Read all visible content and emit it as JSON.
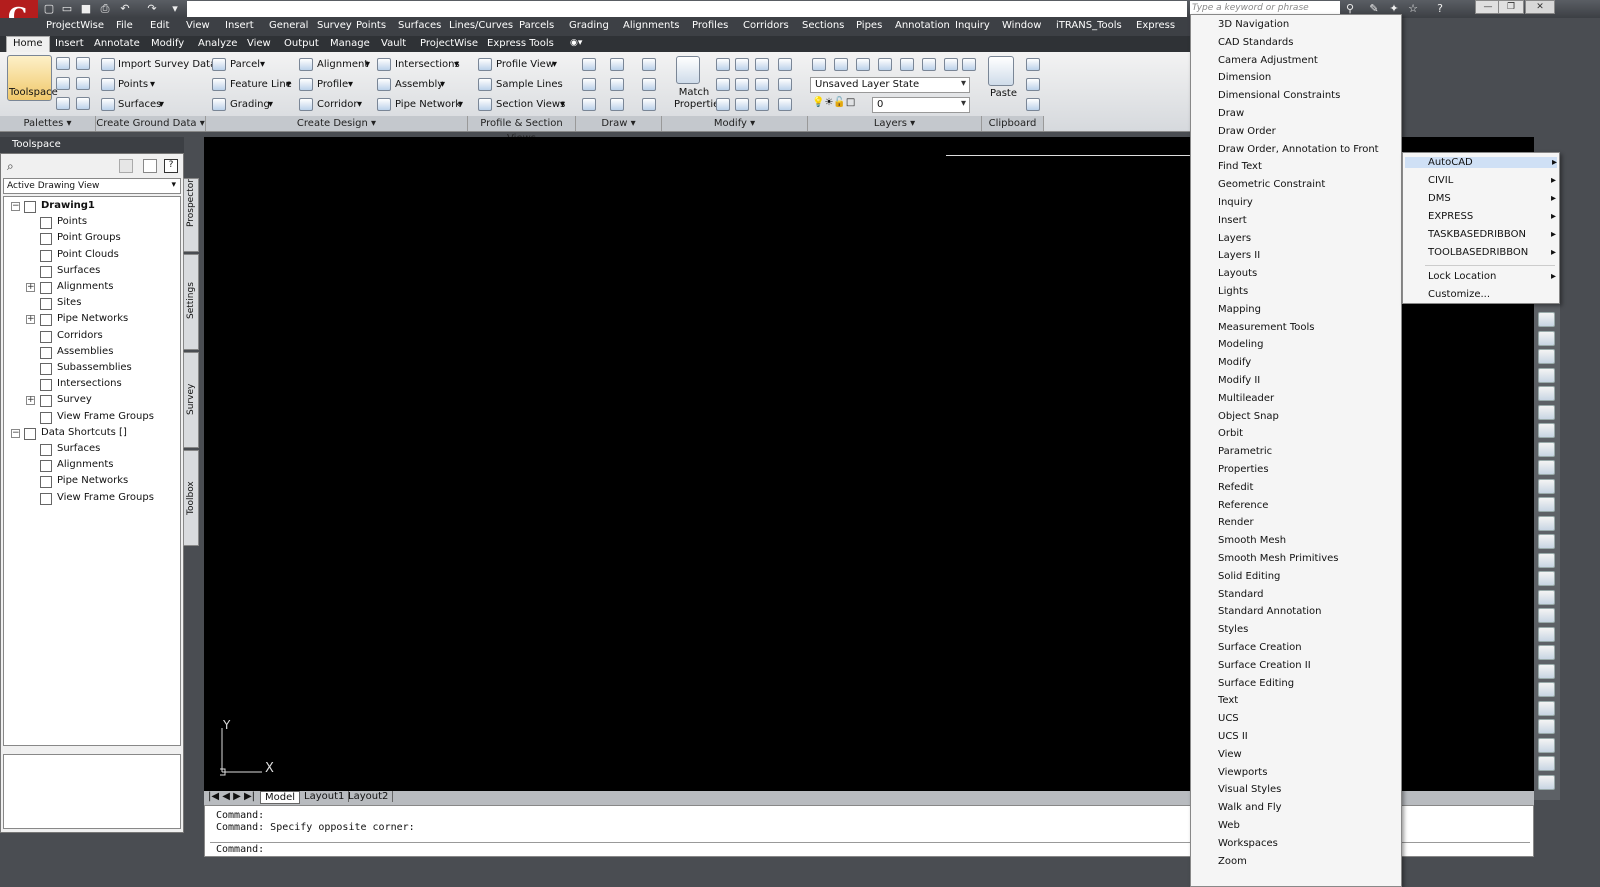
{
  "title_bar": {
    "quick_access_icons": [
      "new-icon",
      "open-icon",
      "save-icon",
      "print-icon",
      "undo-icon",
      "redo-icon"
    ],
    "search_placeholder": "Type a keyword or phrase",
    "window_buttons": [
      "—",
      "❐",
      "✕"
    ]
  },
  "menubar": [
    "ProjectWise",
    "File",
    "Edit",
    "View",
    "Insert",
    "General",
    "Survey",
    "Points",
    "Surfaces",
    "Lines/Curves",
    "Parcels",
    "Grading",
    "Alignments",
    "Profiles",
    "Corridors",
    "Sections",
    "Pipes",
    "Annotation",
    "Inquiry",
    "Window",
    "iTRANS_Tools",
    "Express"
  ],
  "ribbon_tabs": [
    "Home",
    "Insert",
    "Annotate",
    "Modify",
    "Analyze",
    "View",
    "Output",
    "Manage",
    "Vault",
    "ProjectWise",
    "Express Tools"
  ],
  "ribbon": {
    "palettes": {
      "toolspace": "Toolspace",
      "label": "Palettes"
    },
    "create_ground": {
      "import_survey": "Import Survey Data",
      "points": "Points",
      "surfaces": "Surfaces",
      "label": "Create Ground Data"
    },
    "create_design": {
      "parcel": "Parcel",
      "feature_line": "Feature Line",
      "grading": "Grading",
      "alignment": "Alignment",
      "profile": "Profile",
      "corridor": "Corridor",
      "intersections": "Intersections",
      "assembly": "Assembly",
      "pipe_network": "Pipe Network",
      "label": "Create Design"
    },
    "profile_section": {
      "profile_view": "Profile View",
      "sample_lines": "Sample Lines",
      "section_views": "Section Views",
      "label": "Profile & Section Views"
    },
    "draw": {
      "label": "Draw"
    },
    "modify": {
      "match_properties": "Match Properties",
      "label": "Modify"
    },
    "layers": {
      "layer_state": "Unsaved Layer State",
      "current_layer": "0",
      "label": "Layers"
    },
    "clipboard": {
      "paste": "Paste",
      "label": "Clipboard"
    }
  },
  "toolspace": {
    "title": "Toolspace",
    "view_selector": "Active Drawing View",
    "tree": [
      {
        "label": "Drawing1",
        "level": 0,
        "exp": "-",
        "bold": true
      },
      {
        "label": "Points",
        "level": 1
      },
      {
        "label": "Point Groups",
        "level": 1
      },
      {
        "label": "Point Clouds",
        "level": 1
      },
      {
        "label": "Surfaces",
        "level": 1
      },
      {
        "label": "Alignments",
        "level": 1,
        "exp": "+"
      },
      {
        "label": "Sites",
        "level": 1
      },
      {
        "label": "Pipe Networks",
        "level": 1,
        "exp": "+"
      },
      {
        "label": "Corridors",
        "level": 1
      },
      {
        "label": "Assemblies",
        "level": 1
      },
      {
        "label": "Subassemblies",
        "level": 1
      },
      {
        "label": "Intersections",
        "level": 1
      },
      {
        "label": "Survey",
        "level": 1,
        "exp": "+"
      },
      {
        "label": "View Frame Groups",
        "level": 1
      },
      {
        "label": "Data Shortcuts []",
        "level": 0,
        "exp": "-"
      },
      {
        "label": "Surfaces",
        "level": 1
      },
      {
        "label": "Alignments",
        "level": 1
      },
      {
        "label": "Pipe Networks",
        "level": 1
      },
      {
        "label": "View Frame Groups",
        "level": 1
      }
    ],
    "side_tabs": [
      "Prospector",
      "Settings",
      "Survey",
      "Toolbox"
    ]
  },
  "drawing": {
    "layout_tabs": [
      "Model",
      "Layout1",
      "Layout2"
    ],
    "ucs_x": "X",
    "ucs_y": "Y"
  },
  "command": {
    "history": [
      "Command:",
      "Command: Specify opposite corner:"
    ],
    "prompt": "Command:"
  },
  "toolbar_menu": [
    "3D Navigation",
    "CAD Standards",
    "Camera Adjustment",
    "Dimension",
    "Dimensional Constraints",
    "Draw",
    "Draw Order",
    "Draw Order, Annotation to Front",
    "Find Text",
    "Geometric Constraint",
    "Inquiry",
    "Insert",
    "Layers",
    "Layers II",
    "Layouts",
    "Lights",
    "Mapping",
    "Measurement Tools",
    "Modeling",
    "Modify",
    "Modify II",
    "Multileader",
    "Object Snap",
    "Orbit",
    "Parametric",
    "Properties",
    "Refedit",
    "Reference",
    "Render",
    "Smooth Mesh",
    "Smooth Mesh Primitives",
    "Solid Editing",
    "Standard",
    "Standard Annotation",
    "Styles",
    "Surface Creation",
    "Surface Creation II",
    "Surface Editing",
    "Text",
    "UCS",
    "UCS II",
    "View",
    "Viewports",
    "Visual Styles",
    "Walk and Fly",
    "Web",
    "Workspaces",
    "Zoom"
  ],
  "submenu": [
    {
      "label": "AutoCAD",
      "arrow": "▸"
    },
    {
      "label": "CIVIL",
      "arrow": "▸"
    },
    {
      "label": "DMS",
      "arrow": "▸"
    },
    {
      "label": "EXPRESS",
      "arrow": "▸"
    },
    {
      "label": "TASKBASEDRIBBON",
      "arrow": "▸"
    },
    {
      "label": "TOOLBASEDRIBBON",
      "arrow": "▸"
    },
    {
      "label": "Lock Location",
      "arrow": "▸"
    },
    {
      "label": "Customize...",
      "arrow": ""
    }
  ],
  "colors": {
    "canvas": "#000000",
    "menu_highlight": "#cfe0f5",
    "app_red": "#b31d1d"
  }
}
